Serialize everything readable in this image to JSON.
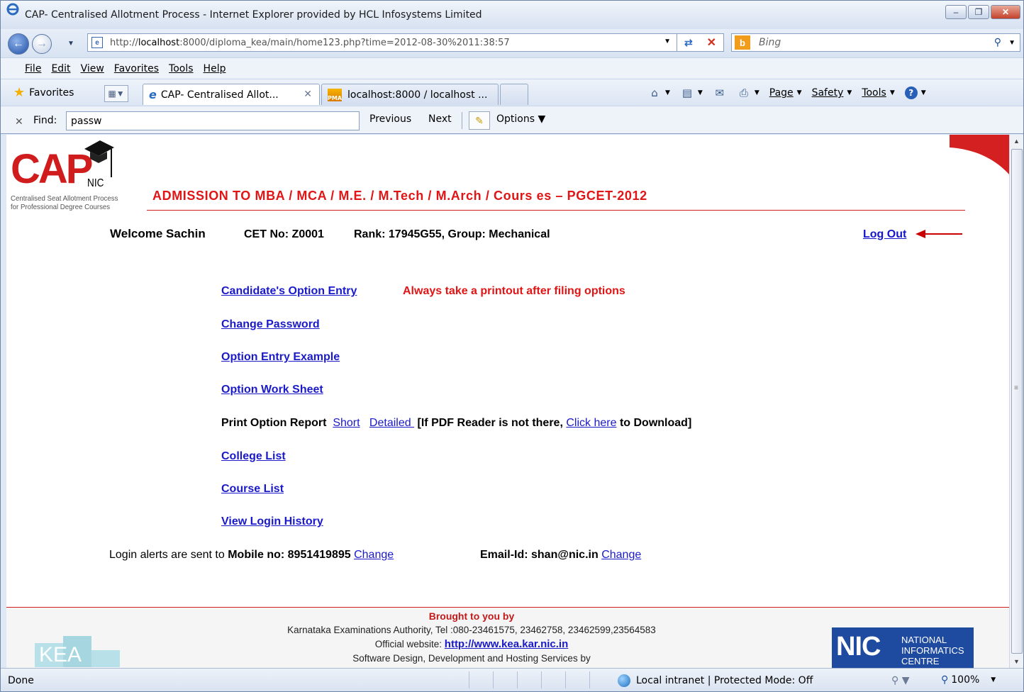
{
  "window": {
    "title": "CAP- Centralised Allotment Process - Internet Explorer provided by HCL Infosystems Limited"
  },
  "address_bar": {
    "url_prefix": "http://",
    "url_host": "localhost",
    "url_rest": ":8000/diploma_kea/main/home123.php?time=2012-08-30%2011:38:57"
  },
  "search_box": {
    "placeholder": "Bing"
  },
  "menu": [
    "File",
    "Edit",
    "View",
    "Favorites",
    "Tools",
    "Help"
  ],
  "favorites_bar": {
    "favorites_label": "Favorites",
    "tabs": [
      {
        "label": "CAP- Centralised Allot...",
        "active": true
      },
      {
        "label": "localhost:8000 / localhost ...",
        "active": false
      }
    ],
    "commands": {
      "page": "Page",
      "safety": "Safety",
      "tools": "Tools"
    }
  },
  "find_bar": {
    "label": "Find:",
    "value": "passw",
    "previous": "Previous",
    "next": "Next",
    "options": "Options"
  },
  "page": {
    "logo": {
      "cap": "CAP",
      "nic": "NIC",
      "tagline_1": "Centralised Seat Allotment Process",
      "tagline_2": "for Professional Degree Courses"
    },
    "heading": "ADMISSION TO MBA / MCA / M.E. / M.Tech / M.Arch / Cours es  – PGCET-2012",
    "welcome": "Welcome Sachin",
    "cet_no": "CET No: Z0001",
    "rank_group": "Rank: 17945G55, Group: Mechanical",
    "logout": "Log Out",
    "links": {
      "option_entry": "Candidate's Option Entry ",
      "change_password": "Change Password",
      "option_entry_example": "Option Entry Example",
      "option_work_sheet": "Option Work Sheet",
      "college_list": "College List",
      "course_list": "Course List",
      "login_history": "View  Login History"
    },
    "warning": "Always take a printout after filing options",
    "print_report": {
      "label": "Print Option Report",
      "short": "Short",
      "detailed": "Detailed ",
      "pdf_text_1": "[If PDF Reader is not there,",
      "click_here": "Click here",
      "pdf_text_2": "to Download]"
    },
    "alerts": {
      "text": "Login alerts are sent to",
      "mobile_label": "Mobile no: 8951419895",
      "change": "Change",
      "email_label": "Email-Id: shan@nic.in"
    },
    "footer": {
      "brought": "Brought to you by",
      "line1": "Karnataka Examinations Authority, Tel :080-23461575, 23462758, 23462599,23564583",
      "line2_text": "Official website:",
      "website": "http://www.kea.kar.nic.in",
      "line3": "Software Design, Development and Hosting Services by",
      "kea_logo_text": "KEA",
      "nic_logo_word": "NIC",
      "nic_logo_full": "NATIONAL INFORMATICS CENTRE"
    }
  },
  "status_bar": {
    "status": "Done",
    "zone": "Local intranet | Protected Mode: Off",
    "zoom": "100%"
  }
}
